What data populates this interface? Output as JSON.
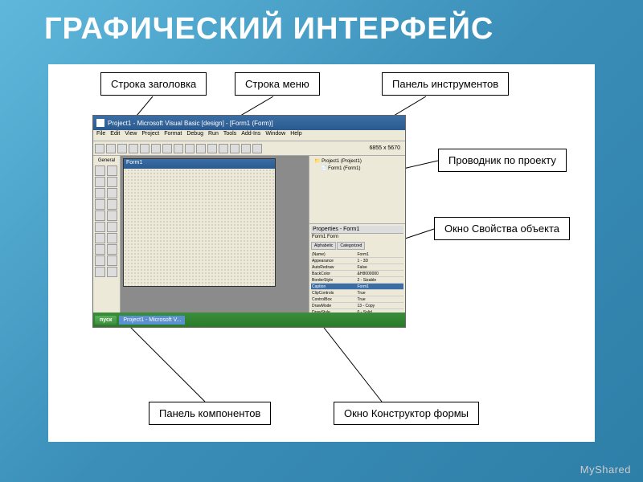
{
  "slide": {
    "title": "ГРАФИЧЕСКИЙ ИНТЕРФЕЙС",
    "watermark": "MyShared"
  },
  "callouts": {
    "titlebar": "Строка заголовка",
    "menu": "Строка меню",
    "toolbar": "Панель инструментов",
    "project_explorer": "Проводник по проекту",
    "properties": "Окно Свойства объекта",
    "designer": "Окно Конструктор формы",
    "components": "Панель компонентов"
  },
  "ide": {
    "title": "Project1 - Microsoft Visual Basic [design] - [Form1 (Form)]",
    "menu": [
      "File",
      "Edit",
      "View",
      "Project",
      "Format",
      "Debug",
      "Run",
      "Tools",
      "Add-Ins",
      "Window",
      "Help"
    ],
    "coordinates": "6855 x 5670",
    "toolbox_title": "General",
    "form_title": "Form1",
    "project_tree": {
      "root": "Project1 (Project1)",
      "child": "Form1 (Form1)"
    },
    "properties_header": "Properties - Form1",
    "properties_object": "Form1 Form",
    "properties_tabs": [
      "Alphabetic",
      "Categorized"
    ],
    "properties_rows": [
      {
        "name": "(Name)",
        "value": "Form1"
      },
      {
        "name": "Appearance",
        "value": "1 - 3D"
      },
      {
        "name": "AutoRedraw",
        "value": "False"
      },
      {
        "name": "BackColor",
        "value": "&H8000000"
      },
      {
        "name": "BorderStyle",
        "value": "2 - Sizable"
      },
      {
        "name": "Caption",
        "value": "Form1"
      },
      {
        "name": "ClipControls",
        "value": "True"
      },
      {
        "name": "ControlBox",
        "value": "True"
      },
      {
        "name": "DrawMode",
        "value": "13 - Copy"
      },
      {
        "name": "DrawStyle",
        "value": "0 - Solid"
      }
    ],
    "taskbar": {
      "start": "пуск",
      "task": "Project1 - Microsoft V..."
    }
  }
}
